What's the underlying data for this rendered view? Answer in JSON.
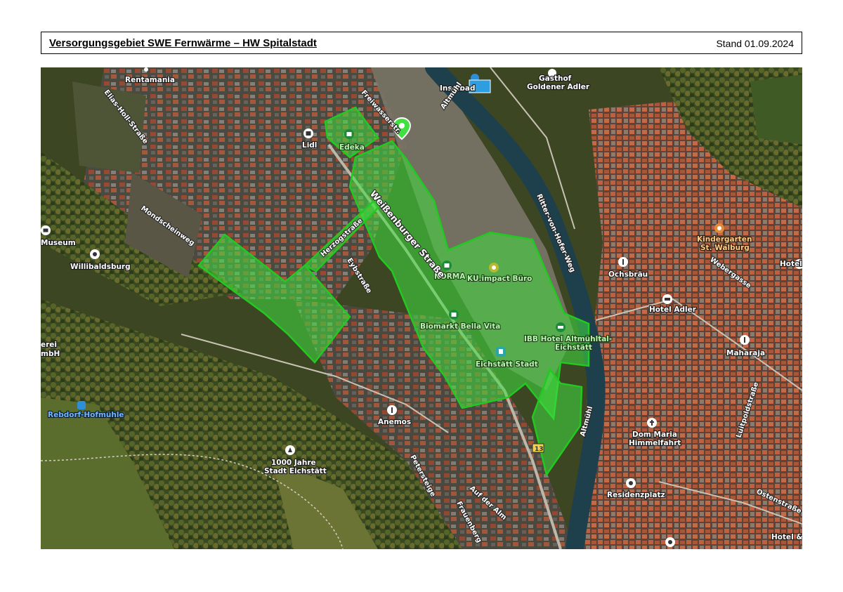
{
  "header": {
    "title": "Versorgungsgebiet SWE Fernwärme – HW Spitalstadt",
    "date": "Stand 01.09.2024"
  },
  "colors": {
    "supply_area_fill": "#3fe03f",
    "supply_area_stroke": "#22c922",
    "river": "#1e3f4c",
    "pin": "#3fe03f"
  },
  "map": {
    "places": {
      "rentamania": "Rentamania",
      "lidl": "Lidl",
      "edeka": "Edeka",
      "inselbad": "Inselbad",
      "gasthof": "Gasthof",
      "goldener_adler": "Goldener Adler",
      "museum": "Museum",
      "willibaldsburg": "Willibaldsburg",
      "norma": "NORMA",
      "ku_impact": "KU.impact Büro",
      "biomarkt": "Biomarkt Bella Vita",
      "ibb_hotel_1": "IBB Hotel Altmühltal-",
      "ibb_hotel_2": "Eichstätt",
      "eichstatt_stadt": "Eichstätt Stadt",
      "kindergarten_1": "Kindergarten",
      "kindergarten_2": "St. Walburg",
      "ochsbrau": "Ochsbräu",
      "hotel_adler": "Hotel Adler",
      "hotel_right": "Hotel",
      "maharaja": "Maharaja",
      "dom_1": "Dom Maria",
      "dom_2": "Himmelfahrt",
      "residenzplatz": "Residenzplatz",
      "hotel_c": "Hotel & C",
      "anemos": "Anemos",
      "jahre_1": "1000 Jahre",
      "jahre_2": "Stadt Eichstätt",
      "rebdorf": "Rebdorf-Hofmühle",
      "erei": "erei",
      "mbh": "mbH",
      "route_number": "13"
    },
    "streets": {
      "elias_holl": "Elias-Holl-Straße",
      "freiwasser": "Freiwasserstr.",
      "altmuhl_top": "Altmühl",
      "weissenburger": "Weißenburger Straße",
      "herzogstrasse": "Herzogstraße",
      "eybstrasse": "Eybstraße",
      "mondscheinweg": "Mondscheinweg",
      "ritter_von_hofer": "Ritter-von-Hofer-Weg",
      "webergasse": "Webergasse",
      "luitpold": "Luitpoldstraße",
      "ostenstrasse": "Ostenstraße",
      "petersteige": "Petersteige",
      "auf_der_alm": "Auf der Alm",
      "frauenberg": "Frauenberg",
      "altmuhl_bottom": "Altmühl"
    },
    "icons": {
      "shop": "shopping-bag-icon",
      "pool": "pool-icon",
      "restaurant": "cutlery-icon",
      "museum": "museum-icon",
      "hotel": "bed-icon",
      "train": "train-icon",
      "church": "church-icon",
      "monument": "monument-icon",
      "camera": "camera-icon",
      "pin": "location-pin-icon"
    }
  }
}
